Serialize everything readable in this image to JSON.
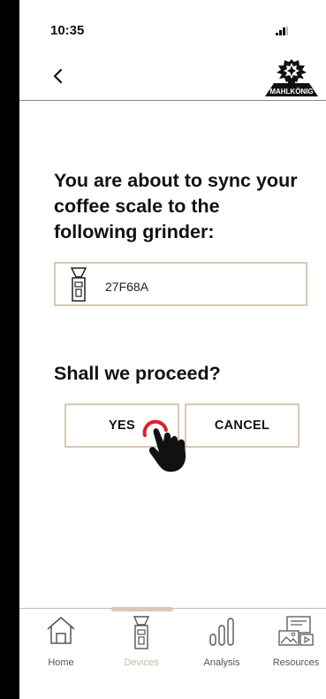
{
  "status": {
    "time": "10:35"
  },
  "header": {
    "brand": "MAHLKÖNIG"
  },
  "main": {
    "heading": "You are about to sync your coffee scale to the following grinder:",
    "device_id": "27F68A",
    "question": "Shall we proceed?",
    "yes_label": "YES",
    "cancel_label": "CANCEL"
  },
  "tabs": [
    {
      "label": "Home",
      "icon": "home-icon",
      "active": false
    },
    {
      "label": "Devices",
      "icon": "grinder-icon",
      "active": true
    },
    {
      "label": "Analysis",
      "icon": "analysis-icon",
      "active": false
    },
    {
      "label": "Resources",
      "icon": "resources-icon",
      "active": false
    }
  ],
  "colors": {
    "accent": "#d8c8b4",
    "active_tab": "#c9b9a6",
    "tap_ring": "#e0202a"
  }
}
